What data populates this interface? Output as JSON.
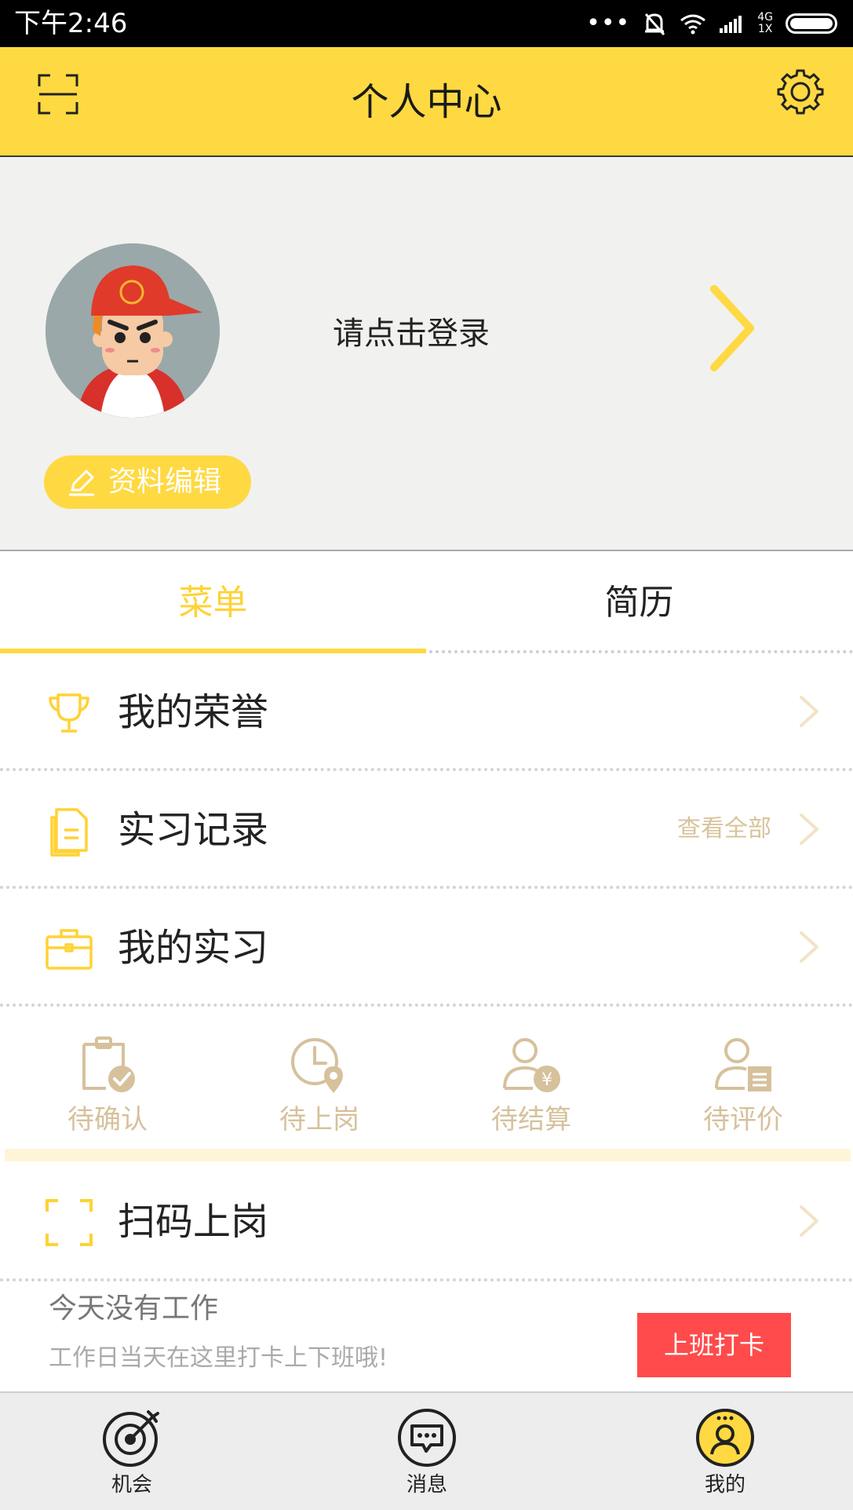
{
  "status_bar": {
    "time": "下午2:46",
    "network_top": "4G",
    "network_bottom": "1X"
  },
  "header": {
    "title": "个人中心"
  },
  "profile": {
    "login_prompt": "请点击登录",
    "edit_label": "资料编辑"
  },
  "tabs": [
    {
      "label": "菜单",
      "active": true
    },
    {
      "label": "简历",
      "active": false
    }
  ],
  "menu": {
    "honor": {
      "label": "我的荣誉"
    },
    "records": {
      "label": "实习记录",
      "extra": "查看全部"
    },
    "internship": {
      "label": "我的实习"
    },
    "scan": {
      "label": "扫码上岗"
    }
  },
  "status_items": [
    {
      "label": "待确认",
      "icon": "clipboard-check-icon"
    },
    {
      "label": "待上岗",
      "icon": "clock-location-icon"
    },
    {
      "label": "待结算",
      "icon": "user-yen-icon"
    },
    {
      "label": "待评价",
      "icon": "user-document-icon"
    }
  ],
  "clock_in": {
    "title": "今天没有工作",
    "subtitle": "工作日当天在这里打卡上下班哦!",
    "button": "上班打卡"
  },
  "nav": [
    {
      "label": "机会",
      "icon": "target-icon"
    },
    {
      "label": "消息",
      "icon": "message-icon"
    },
    {
      "label": "我的",
      "icon": "profile-icon",
      "active": true
    }
  ],
  "colors": {
    "accent": "#ffd942",
    "muted_gold": "#d6c19c",
    "clock_button": "#ff4b4b"
  }
}
